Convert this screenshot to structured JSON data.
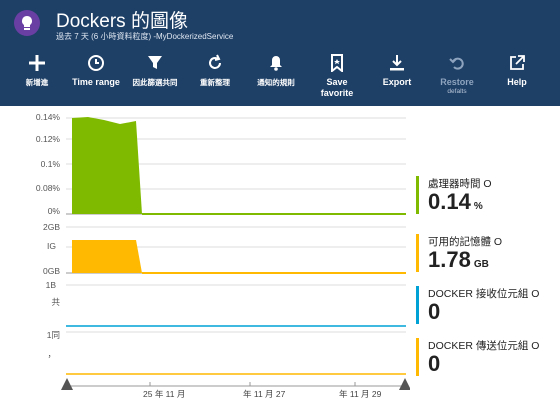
{
  "header": {
    "title": "Dockers 的圖像",
    "subtitle": "過去 7 天 (6 小時資料粒度) -MyDockerizedService"
  },
  "toolbar": {
    "add": "新增進",
    "time_range": "Time range",
    "filter": "因此篩選共同",
    "refresh": "重新整理",
    "alerts": "通知的規則",
    "save_favorite": "Save favorite",
    "export": "Export",
    "restore": "Restore",
    "restore_sub": "defalts",
    "help": "Help"
  },
  "charts": {
    "cpu": {
      "ticks": [
        "0.14%",
        "0.12%",
        "0.1%",
        "0.08%",
        "0%"
      ]
    },
    "memory": {
      "ticks": [
        "2GB",
        "IG",
        "0GB"
      ]
    },
    "rx": {
      "ticks": [
        "1B",
        "共"
      ]
    },
    "tx": {
      "ticks": [
        "1同",
        "，"
      ]
    },
    "x_labels": [
      "25 年 11 月",
      "年 11 月 27",
      "年 11 月 29"
    ]
  },
  "metrics": [
    {
      "name": "處理器時間 O",
      "value": "0.14",
      "unit": "%",
      "color": "#7fba00"
    },
    {
      "name": "可用的記憶體 O",
      "value": "1.78",
      "unit": "GB",
      "color": "#ffb900"
    },
    {
      "name": "DOCKER 接收位元組 O",
      "value": "0",
      "unit": "",
      "color": "#00a2d6"
    },
    {
      "name": "DOCKER 傳送位元組 O",
      "value": "0",
      "unit": "",
      "color": "#ffb900"
    }
  ],
  "icons": {
    "app": "lightbulb-icon",
    "add": "plus-icon",
    "time_range": "clock-icon",
    "filter": "funnel-icon",
    "refresh": "refresh-icon",
    "alerts": "bell-icon",
    "save_favorite": "bookmark-icon",
    "export": "download-icon",
    "restore": "undo-icon",
    "help": "external-link-icon"
  },
  "colors": {
    "header_bg": "#1e3f66",
    "cpu": "#7fba00",
    "memory": "#ffb900",
    "rx": "#00a2d6",
    "tx": "#ffb900"
  }
}
